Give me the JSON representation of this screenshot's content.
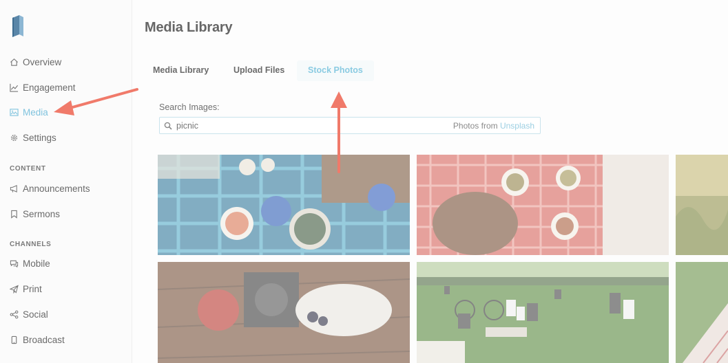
{
  "sidebar": {
    "logo": "book-logo",
    "items": [
      {
        "label": "Overview",
        "icon": "home-icon"
      },
      {
        "label": "Engagement",
        "icon": "chart-line-icon"
      },
      {
        "label": "Media",
        "icon": "image-icon",
        "active": true
      },
      {
        "label": "Settings",
        "icon": "gear-icon"
      }
    ],
    "sections": [
      {
        "heading": "CONTENT",
        "items": [
          {
            "label": "Announcements",
            "icon": "megaphone-icon"
          },
          {
            "label": "Sermons",
            "icon": "bookmark-icon"
          }
        ]
      },
      {
        "heading": "CHANNELS",
        "items": [
          {
            "label": "Mobile",
            "icon": "chat-icon"
          },
          {
            "label": "Print",
            "icon": "paper-plane-icon"
          },
          {
            "label": "Social",
            "icon": "share-icon"
          },
          {
            "label": "Broadcast",
            "icon": "phone-icon"
          }
        ]
      }
    ]
  },
  "main": {
    "title": "Media Library",
    "tabs": [
      "Media Library",
      "Upload Files",
      "Stock Photos"
    ],
    "active_tab": "Stock Photos",
    "search": {
      "label": "Search Images:",
      "value": "picnic",
      "provider_prefix": "Photos from",
      "provider_link": "Unsplash"
    },
    "photos": [
      "picnic-blanket-food",
      "picnic-basket-red-blanket",
      "grass-field",
      "apple-camera-table",
      "park-picnic-crowd",
      "picnic-cloth-grass"
    ]
  },
  "colors": {
    "accent": "#7fc3de",
    "annotation_arrow": "#f07a6a"
  }
}
